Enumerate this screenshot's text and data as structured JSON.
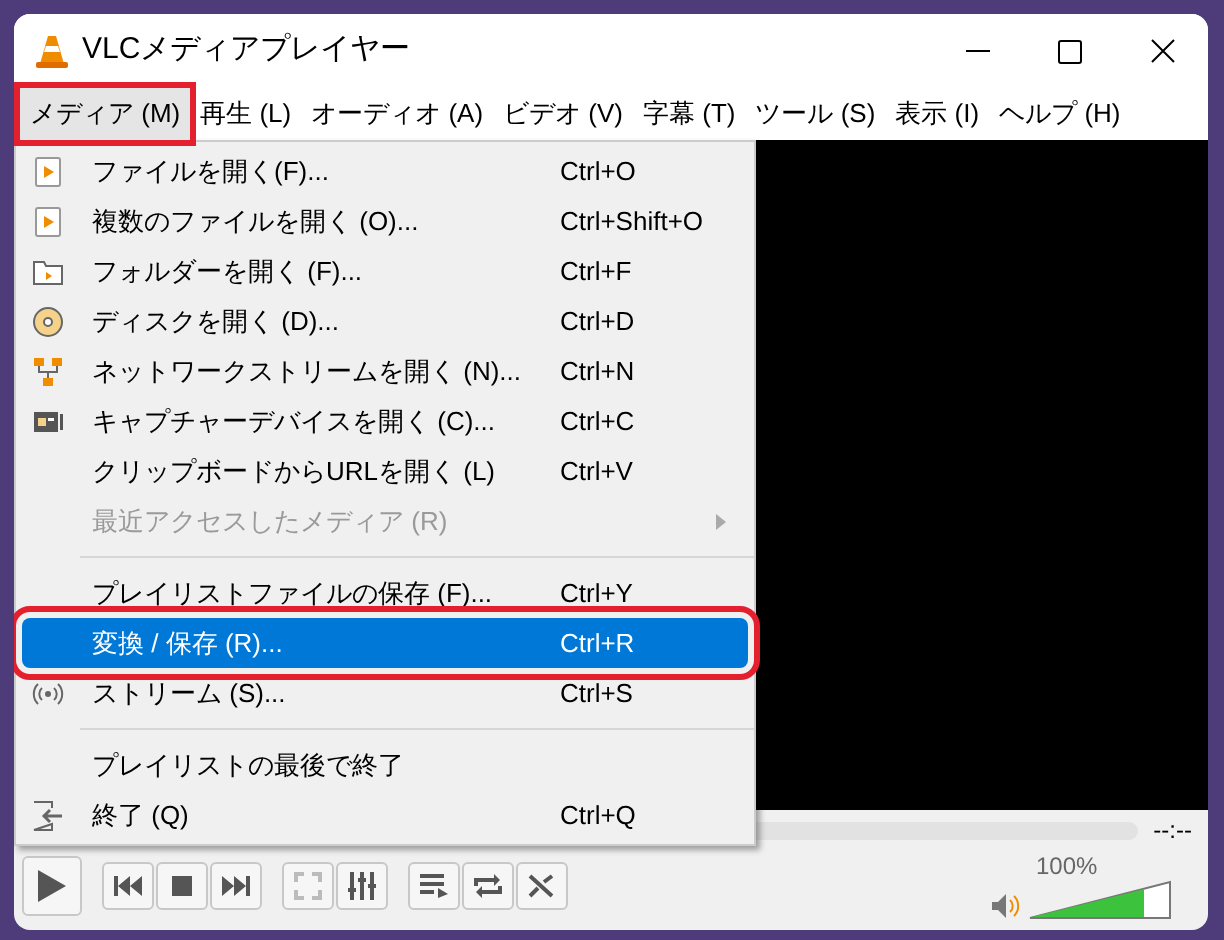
{
  "window": {
    "title": "VLCメディアプレイヤー"
  },
  "menubar": [
    {
      "label": "メディア (M)",
      "selected": true,
      "annotated": true
    },
    {
      "label": "再生 (L)",
      "selected": false,
      "annotated": false
    },
    {
      "label": "オーディオ (A)",
      "selected": false,
      "annotated": false
    },
    {
      "label": "ビデオ (V)",
      "selected": false,
      "annotated": false
    },
    {
      "label": "字幕 (T)",
      "selected": false,
      "annotated": false
    },
    {
      "label": "ツール (S)",
      "selected": false,
      "annotated": false
    },
    {
      "label": "表示 (I)",
      "selected": false,
      "annotated": false
    },
    {
      "label": "ヘルプ (H)",
      "selected": false,
      "annotated": false
    }
  ],
  "menu": [
    {
      "kind": "item",
      "label": "ファイルを開く(F)...",
      "shortcut": "Ctrl+O",
      "disabled": false,
      "selected": false,
      "submenu": false,
      "annotated": false
    },
    {
      "kind": "item",
      "label": "複数のファイルを開く (O)...",
      "shortcut": "Ctrl+Shift+O",
      "disabled": false,
      "selected": false,
      "submenu": false,
      "annotated": false
    },
    {
      "kind": "item",
      "label": "フォルダーを開く (F)...",
      "shortcut": "Ctrl+F",
      "disabled": false,
      "selected": false,
      "submenu": false,
      "annotated": false
    },
    {
      "kind": "item",
      "label": "ディスクを開く (D)...",
      "shortcut": "Ctrl+D",
      "disabled": false,
      "selected": false,
      "submenu": false,
      "annotated": false
    },
    {
      "kind": "item",
      "label": "ネットワークストリームを開く (N)...",
      "shortcut": "Ctrl+N",
      "disabled": false,
      "selected": false,
      "submenu": false,
      "annotated": false
    },
    {
      "kind": "item",
      "label": "キャプチャーデバイスを開く (C)...",
      "shortcut": "Ctrl+C",
      "disabled": false,
      "selected": false,
      "submenu": false,
      "annotated": false
    },
    {
      "kind": "item",
      "label": "クリップボードからURLを開く (L)",
      "shortcut": "Ctrl+V",
      "disabled": false,
      "selected": false,
      "submenu": false,
      "annotated": false
    },
    {
      "kind": "item",
      "label": "最近アクセスしたメディア (R)",
      "disabled": true,
      "selected": false,
      "submenu": true,
      "annotated": false
    },
    {
      "kind": "separator"
    },
    {
      "kind": "item",
      "label": "プレイリストファイルの保存 (F)...",
      "shortcut": "Ctrl+Y",
      "disabled": false,
      "selected": false,
      "submenu": false,
      "annotated": false
    },
    {
      "kind": "item",
      "label": "変換 / 保存 (R)...",
      "shortcut": "Ctrl+R",
      "disabled": false,
      "selected": true,
      "submenu": false,
      "annotated": true
    },
    {
      "kind": "item",
      "label": "ストリーム (S)...",
      "shortcut": "Ctrl+S",
      "disabled": false,
      "selected": false,
      "submenu": false,
      "annotated": false
    },
    {
      "kind": "separator"
    },
    {
      "kind": "item",
      "label": "プレイリストの最後で終了",
      "disabled": false,
      "selected": false,
      "submenu": false,
      "annotated": false
    },
    {
      "kind": "item",
      "label": "終了 (Q)",
      "shortcut": "Ctrl+Q",
      "disabled": false,
      "selected": false,
      "submenu": false,
      "annotated": false
    }
  ],
  "seek": {
    "time_remaining": "--:--"
  },
  "volume": {
    "reading": "100%",
    "level": 0.8
  }
}
